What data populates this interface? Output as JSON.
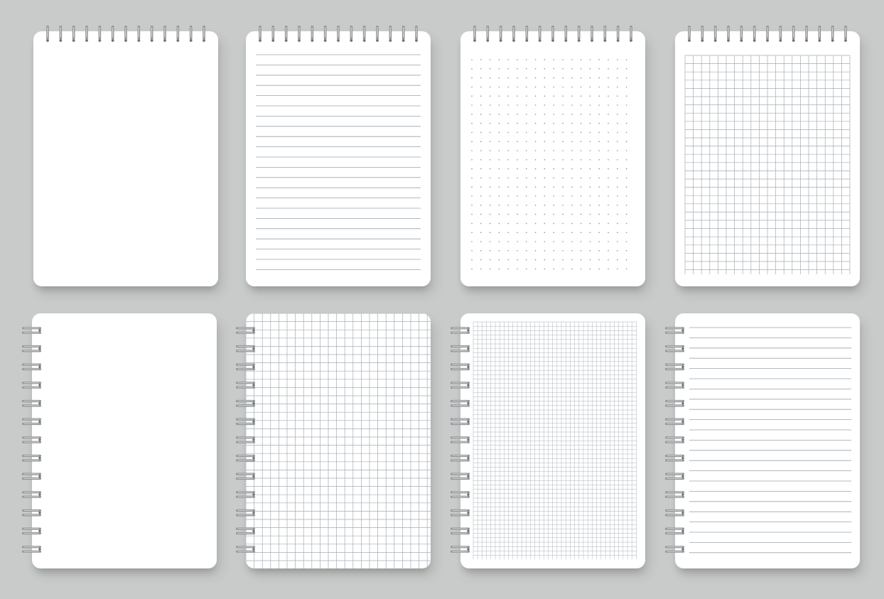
{
  "scene": {
    "background_color": "#c8cbca",
    "paper_color": "#ffffff",
    "line_color": "#9aa4ac",
    "grid_color": "#a4adb4",
    "dot_color": "#8a939a",
    "coil_color": "#8f9396",
    "coil_highlight": "#d6d8d9"
  },
  "notebooks": [
    {
      "name": "notebook-top-binding-blank",
      "binding": "top",
      "ruling": "blank"
    },
    {
      "name": "notebook-top-binding-lined",
      "binding": "top",
      "ruling": "lined"
    },
    {
      "name": "notebook-top-binding-dotted",
      "binding": "top",
      "ruling": "dotted"
    },
    {
      "name": "notebook-top-binding-grid",
      "binding": "top",
      "ruling": "grid"
    },
    {
      "name": "notebook-side-binding-blank",
      "binding": "left",
      "ruling": "blank"
    },
    {
      "name": "notebook-side-binding-grid",
      "binding": "left",
      "ruling": "grid"
    },
    {
      "name": "notebook-side-binding-fine-grid",
      "binding": "left",
      "ruling": "fine-grid"
    },
    {
      "name": "notebook-side-binding-lined",
      "binding": "left",
      "ruling": "lined"
    }
  ]
}
